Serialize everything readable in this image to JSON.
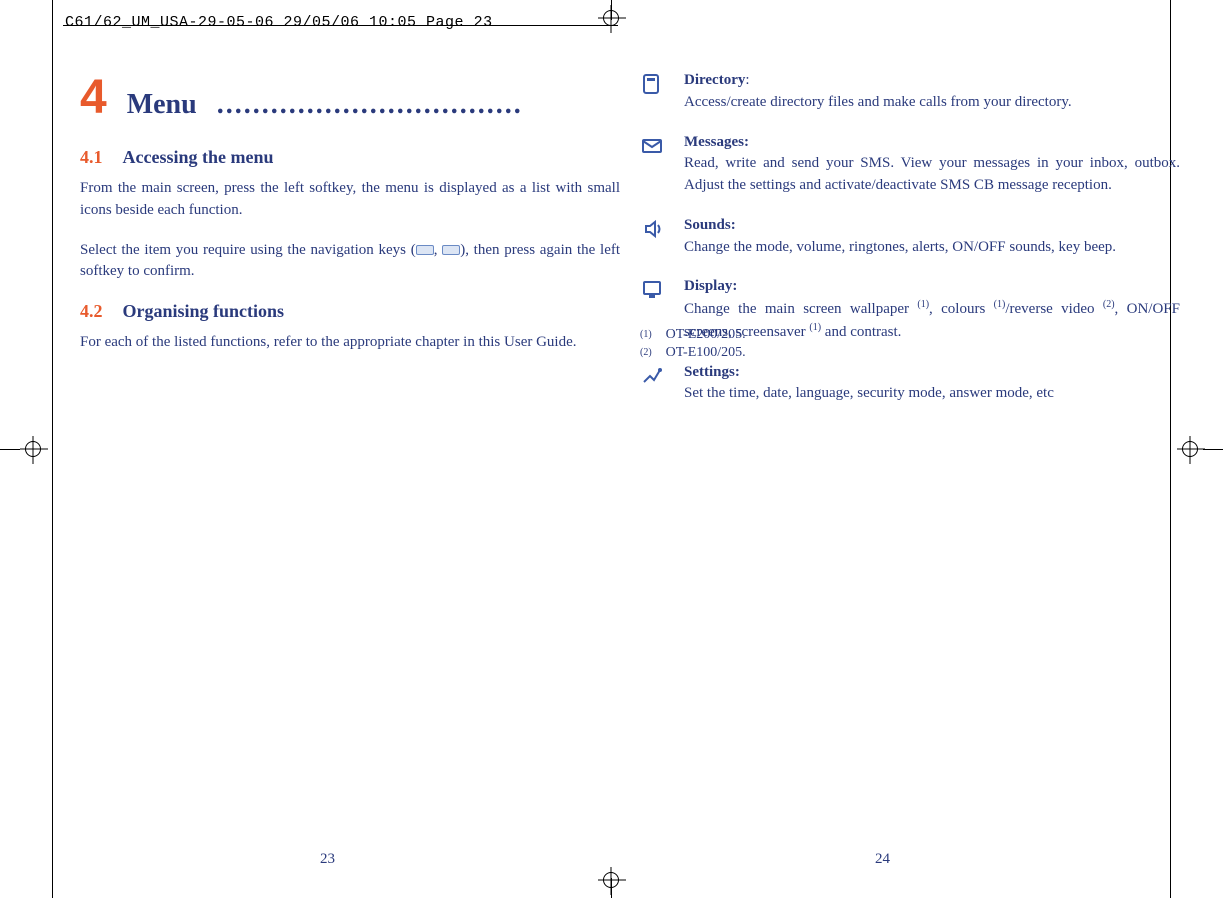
{
  "header": "C61/62_UM_USA-29-05-06  29/05/06  10:05  Page 23",
  "leftPage": {
    "chapterNum": "4",
    "chapterTitle": "Menu",
    "sections": [
      {
        "num": "4.1",
        "title": "Accessing the menu",
        "paras": [
          "From the main screen, press the left softkey, the menu is displayed as a list with small icons beside each function.",
          "Select the item you require using the navigation keys ( , ), then press again the left softkey to confirm."
        ]
      },
      {
        "num": "4.2",
        "title": "Organising functions",
        "paras": [
          "For each of the listed functions, refer to the appropriate chapter in this User Guide."
        ]
      }
    ],
    "pageNumber": "23"
  },
  "rightPage": {
    "items": [
      {
        "title": "Directory",
        "sep": ":",
        "desc": "Access/create directory files and make calls from your directory."
      },
      {
        "title": "Messages:",
        "sep": "",
        "desc": "Read, write and send your SMS. View your messages in your inbox, outbox. Adjust the settings and activate/deactivate SMS CB message reception."
      },
      {
        "title": "Sounds:",
        "sep": "",
        "desc": "Change the mode, volume, ringtones, alerts, ON/OFF sounds, key beep."
      },
      {
        "title": "Display:",
        "sep": "",
        "desc_html": "Change the main screen wallpaper <sup>(1)</sup>, colours <sup>(1)</sup>/reverse video <sup>(2)</sup>, ON/OFF screens, screensaver <sup>(1)</sup> and contrast."
      },
      {
        "title": "Settings:",
        "sep": "",
        "desc": "Set the time, date, language, security mode, answer mode, etc"
      }
    ],
    "footnotes": [
      {
        "mark": "(1)",
        "text": "OT-E200/205."
      },
      {
        "mark": "(2)",
        "text": "OT-E100/205."
      }
    ],
    "pageNumber": "24"
  }
}
